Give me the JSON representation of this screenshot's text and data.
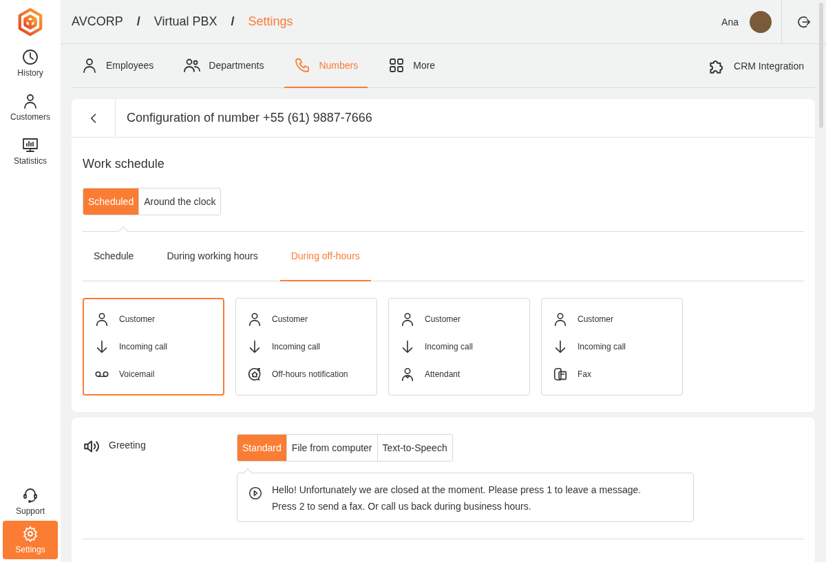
{
  "sidebar": {
    "items": [
      {
        "label": "History",
        "kind": "clock",
        "selected": false
      },
      {
        "label": "Customers",
        "kind": "person",
        "selected": false
      },
      {
        "label": "Statistics",
        "kind": "monitor",
        "selected": false
      }
    ],
    "bottom_items": [
      {
        "label": "Support",
        "kind": "headset",
        "selected": false
      },
      {
        "label": "Settings",
        "kind": "gear",
        "selected": true
      }
    ]
  },
  "breadcrumb": [
    {
      "label": "AVCORP",
      "current": false
    },
    {
      "label": "/",
      "kind": "sep"
    },
    {
      "label": "Virtual PBX",
      "current": false
    },
    {
      "label": "/",
      "kind": "sep"
    },
    {
      "label": "Settings",
      "current": true
    }
  ],
  "user": {
    "name": "Ana"
  },
  "nav_tabs": [
    {
      "label": "Employees",
      "kind": "person",
      "selected": false
    },
    {
      "label": "Departments",
      "kind": "people",
      "selected": false
    },
    {
      "label": "Numbers",
      "kind": "phone",
      "selected": true
    },
    {
      "label": "More",
      "kind": "grid",
      "selected": false
    }
  ],
  "crm_link": {
    "label": "CRM Integration"
  },
  "config": {
    "title": "Configuration of number +55 (61) 9887-7666",
    "work_schedule": {
      "title": "Work schedule",
      "modes": [
        {
          "label": "Scheduled",
          "selected": true
        },
        {
          "label": "Around the clock",
          "selected": false
        }
      ],
      "subtabs": [
        {
          "label": "Schedule",
          "selected": false
        },
        {
          "label": "During working hours",
          "selected": false
        },
        {
          "label": "During off-hours",
          "selected": true
        }
      ],
      "flows": [
        {
          "selected": true,
          "steps": [
            {
              "label": "Customer",
              "kind": "person"
            },
            {
              "label": "Incoming call",
              "kind": "arrow-down"
            },
            {
              "label": "Voicemail",
              "kind": "voicemail"
            }
          ]
        },
        {
          "selected": false,
          "steps": [
            {
              "label": "Customer",
              "kind": "person"
            },
            {
              "label": "Incoming call",
              "kind": "arrow-down"
            },
            {
              "label": "Off-hours notification",
              "kind": "house-bubble"
            }
          ]
        },
        {
          "selected": false,
          "steps": [
            {
              "label": "Customer",
              "kind": "person"
            },
            {
              "label": "Incoming call",
              "kind": "arrow-down"
            },
            {
              "label": "Attendant",
              "kind": "attendant"
            }
          ]
        },
        {
          "selected": false,
          "steps": [
            {
              "label": "Customer",
              "kind": "person"
            },
            {
              "label": "Incoming call",
              "kind": "arrow-down"
            },
            {
              "label": "Fax",
              "kind": "fax"
            }
          ]
        }
      ]
    }
  },
  "greeting": {
    "label": "Greeting",
    "options": [
      {
        "label": "Standard",
        "selected": true
      },
      {
        "label": "File from computer",
        "selected": false
      },
      {
        "label": "Text-to-Speech",
        "selected": false
      }
    ],
    "message": "Hello! Unfortunately we are closed at the moment. Please press 1 to leave a message. Press 2 to send a fax. Or call us back during business hours."
  }
}
